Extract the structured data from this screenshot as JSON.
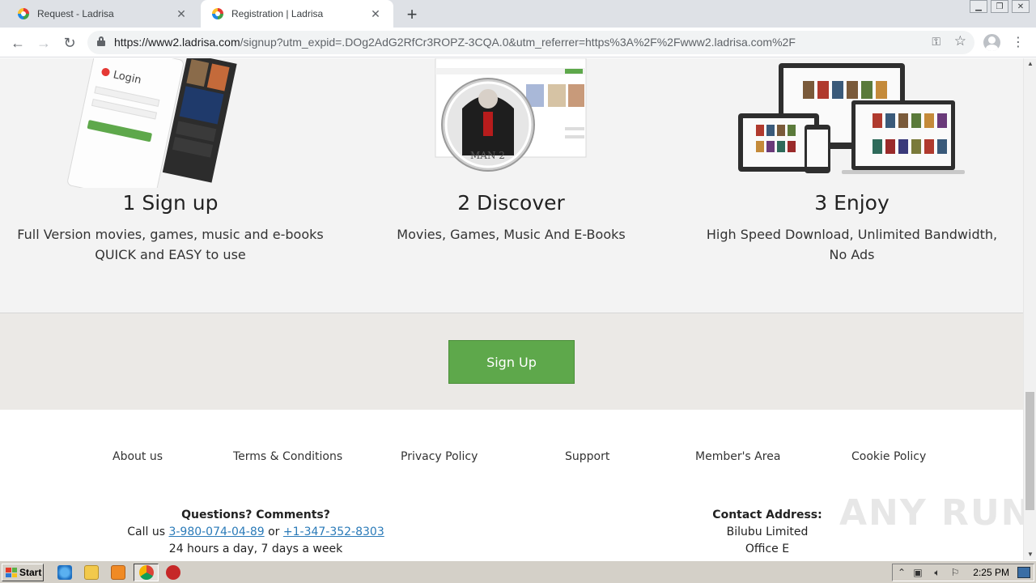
{
  "browser": {
    "tabs": [
      {
        "title": "Request - Ladrisa",
        "active": false
      },
      {
        "title": "Registration | Ladrisa",
        "active": true
      }
    ],
    "url_host": "https://www2.ladrisa.com",
    "url_rest": "/signup?utm_expid=.DOg2AdG2RfCr3ROPZ-3CQA.0&utm_referrer=https%3A%2F%2Fwww2.ladrisa.com%2F"
  },
  "steps": [
    {
      "heading": "1 Sign up",
      "desc": "Full Version movies, games, music and e-books QUICK and EASY to use",
      "login_label": "Login"
    },
    {
      "heading": "2 Discover",
      "desc": "Movies, Games, Music And E-Books",
      "cover_text": "MAN 2"
    },
    {
      "heading": "3 Enjoy",
      "desc": "High Speed Download, Unlimited Bandwidth, No Ads"
    }
  ],
  "cta": {
    "signup_label": "Sign Up"
  },
  "footer": {
    "links": [
      "About us",
      "Terms & Conditions",
      "Privacy Policy",
      "Support",
      "Member's Area",
      "Cookie Policy"
    ],
    "questions_title": "Questions? Comments?",
    "call_prefix": "Call us",
    "phone1": "3-980-074-04-89",
    "or_text": "or",
    "phone2": "+1-347-352-8303",
    "hours": "24 hours a day, 7 days a week",
    "contact_title": "Contact Address:",
    "company": "Bilubu Limited",
    "office": "Office E"
  },
  "watermark": "ANY RUN",
  "taskbar": {
    "start_label": "Start",
    "clock": "2:25 PM"
  },
  "colors": {
    "signup_green": "#5ea84b",
    "link_blue": "#2a7ab8",
    "steps_bg": "#f3f3f3",
    "cta_bg": "#ebe9e6"
  }
}
